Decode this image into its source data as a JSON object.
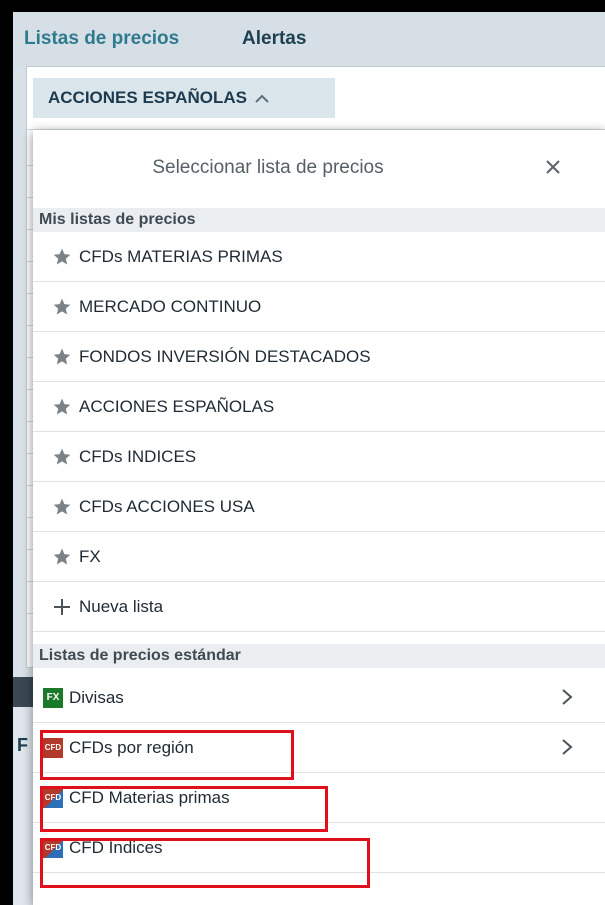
{
  "tabs": {
    "prices": "Listas de precios",
    "alerts": "Alertas"
  },
  "selector": {
    "label": "ACCIONES ESPAÑOLAS"
  },
  "lower": {
    "letter": "F"
  },
  "popup": {
    "title": "Seleccionar lista de precios",
    "my_section": "Mis listas de precios",
    "my_lists": [
      "CFDs MATERIAS PRIMAS",
      "MERCADO CONTINUO",
      "FONDOS INVERSIÓN DESTACADOS",
      "ACCIONES ESPAÑOLAS",
      "CFDs INDICES",
      "CFDs ACCIONES USA",
      "FX"
    ],
    "new_list": "Nueva lista",
    "standard_section": "Listas de precios estándar",
    "standard_lists": [
      {
        "label": "Divisas",
        "badge": "FX",
        "badge_color": "#1a7a2a"
      },
      {
        "label": "CFDs por región",
        "badge": "CFD",
        "badge_color": "#b23a2a"
      },
      {
        "label": "CFD Materias primas",
        "badge": "CFD",
        "badge_color": "#b23a2a"
      },
      {
        "label": "CFD Índices",
        "badge": "CFD",
        "badge_color": "#b23a2a"
      }
    ]
  },
  "colors": {
    "highlight": "#e0101a",
    "accent": "#2f7a8f"
  }
}
